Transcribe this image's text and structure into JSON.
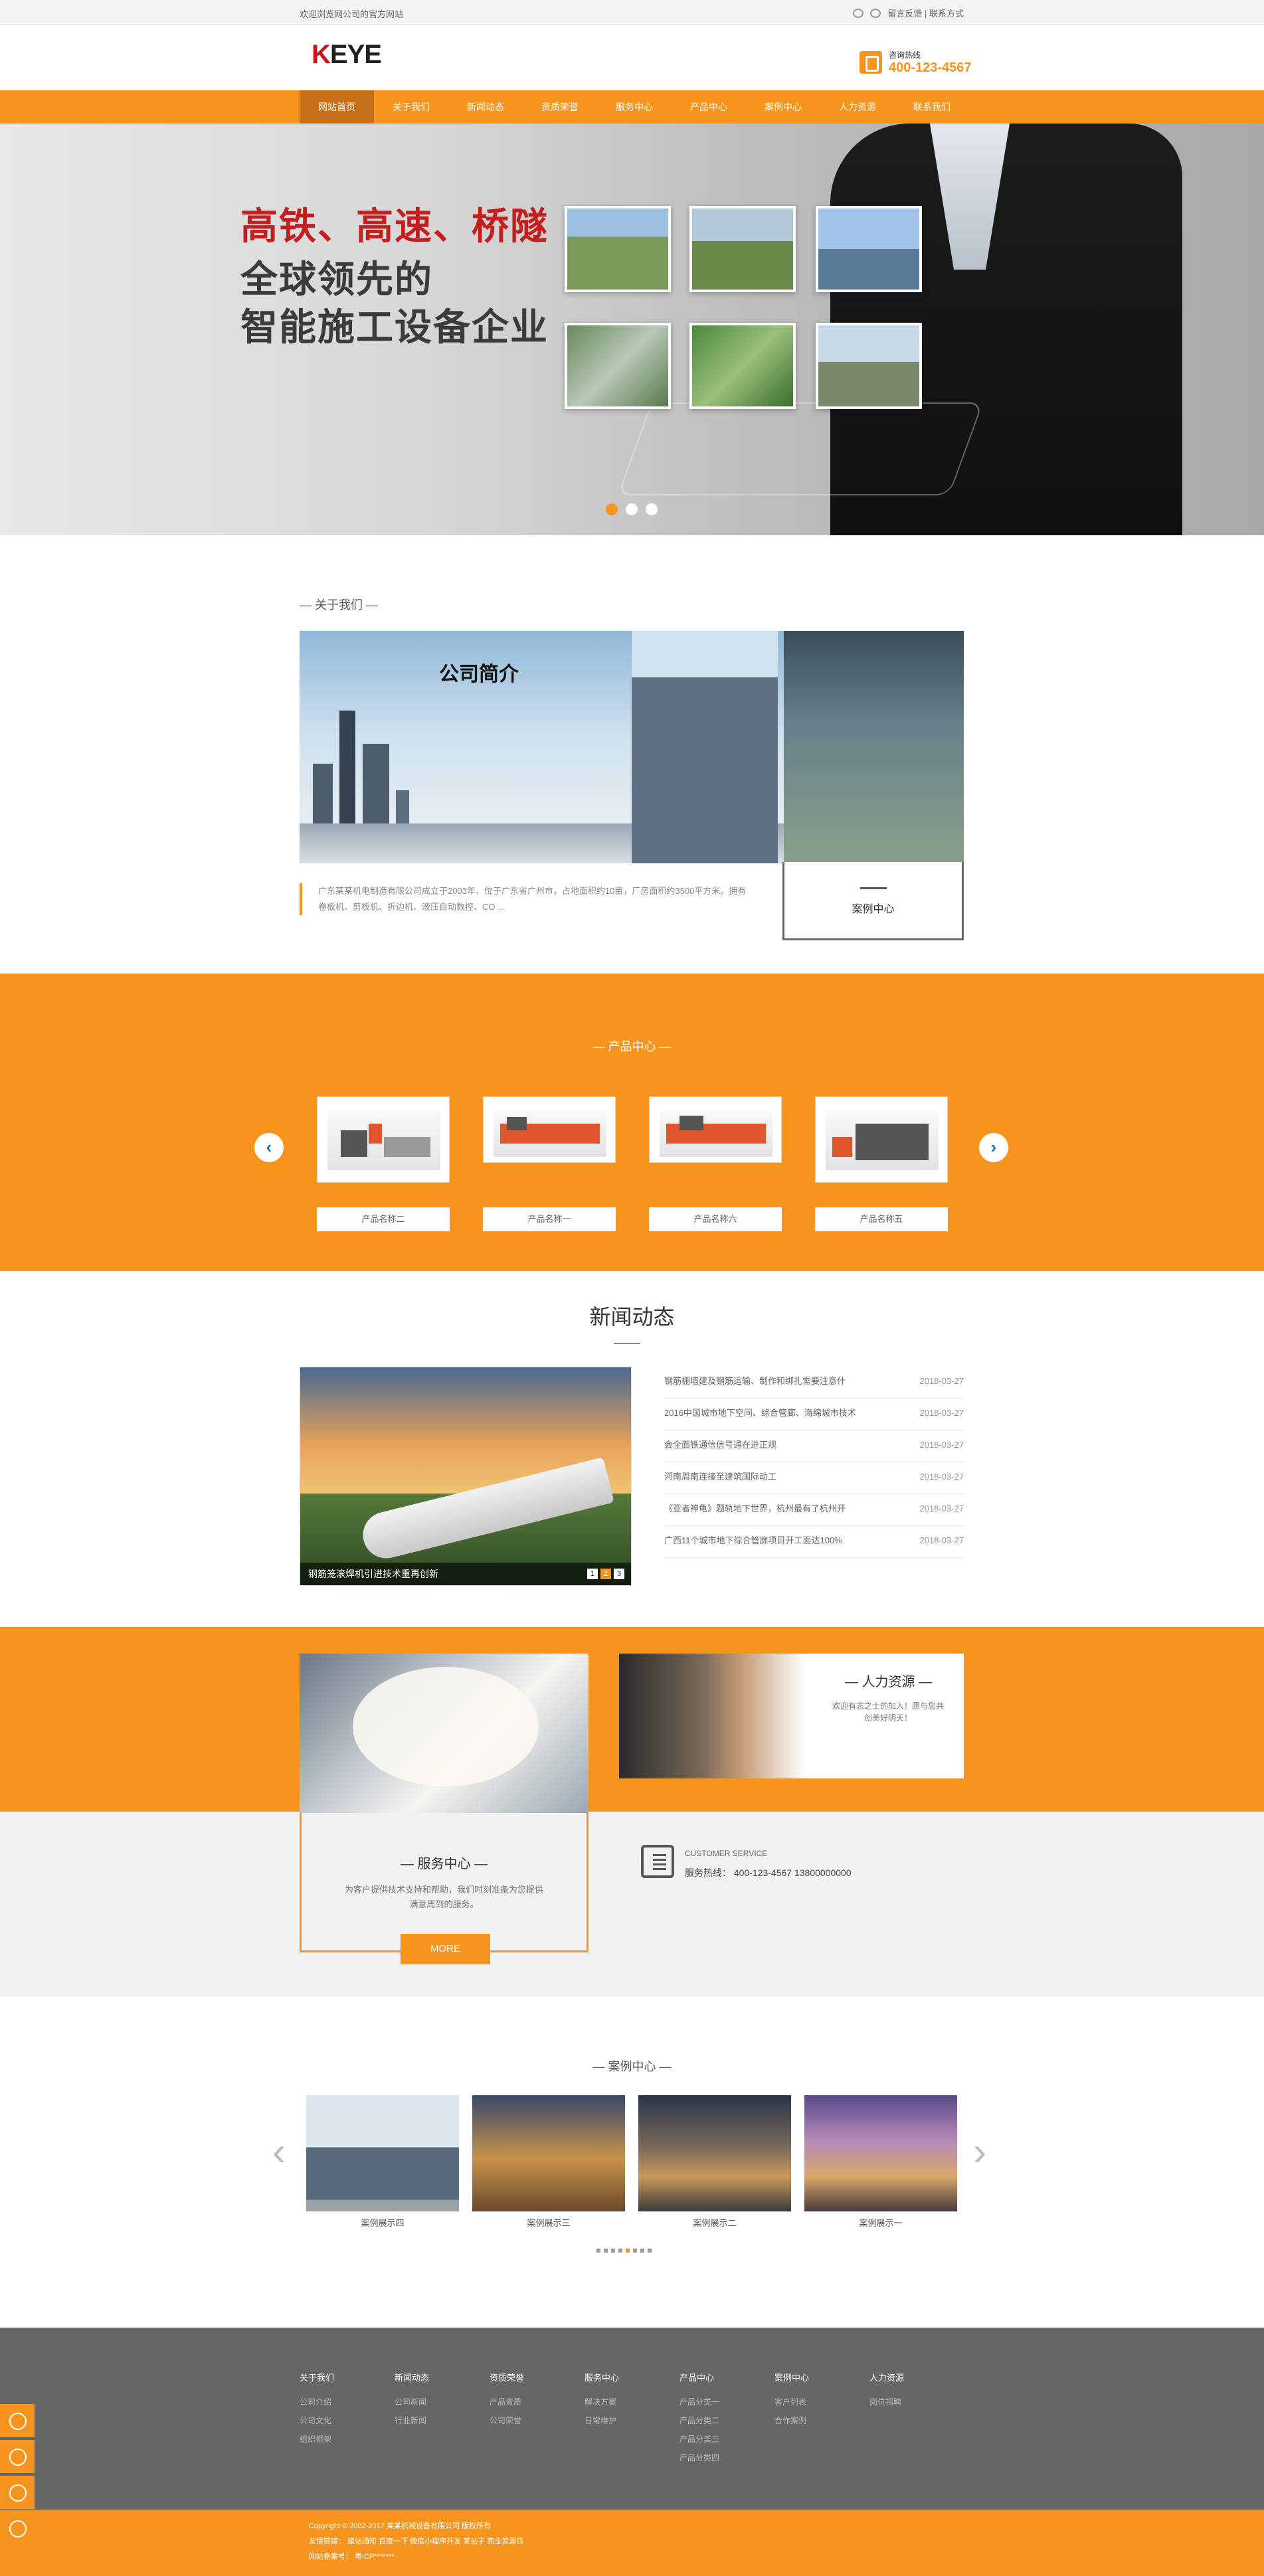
{
  "topbar": {
    "welcome": "欢迎浏览网公司的官方网站",
    "links": "留言反馈 | 联系方式"
  },
  "header": {
    "logo": "KEYE",
    "hotline_label": "咨询热线",
    "hotline_number": "400-123-4567"
  },
  "nav": [
    "网站首页",
    "关于我们",
    "新闻动态",
    "资质荣誉",
    "服务中心",
    "产品中心",
    "案例中心",
    "人力资源",
    "联系我们"
  ],
  "banner": {
    "line1": "高铁、高速、桥隧",
    "line2": "全球领先的",
    "line3": "智能施工设备企业"
  },
  "about": {
    "title": "— 关于我们 —",
    "img_title": "公司简介",
    "text": "广东某某机电制造有限公司成立于2003年，位于广东省广州市，占地面积约10亩，厂房面积约3500平方米。拥有卷板机、剪板机、折边机、液压自动数控、CO ...",
    "case_btn": "案例中心"
  },
  "products": {
    "title": "— 产品中心 —",
    "items": [
      "产品名称二",
      "产品名称一",
      "产品名称六",
      "产品名称五"
    ]
  },
  "news": {
    "title": "新闻动态",
    "caption": "钢筋笼滚焊机引进技术重再创新",
    "pages": [
      "1",
      "2",
      "3"
    ],
    "list": [
      {
        "t": "钢筋棚墙建及钢筋运输、制作和绑扎需要注意什",
        "d": "2018-03-27"
      },
      {
        "t": "2016中国城市地下空间、综合管廊、海绵城市技术",
        "d": "2018-03-27"
      },
      {
        "t": "会全面铁通信信号通在进正规",
        "d": "2018-03-27"
      },
      {
        "t": "河南周南连接至建筑国际动工",
        "d": "2018-03-27"
      },
      {
        "t": "《亚者神龟》题轨地下世界，杭州最有了杭州开",
        "d": "2018-03-27"
      },
      {
        "t": "广西11个城市地下综合管廊项目开工面达100%",
        "d": "2018-03-27"
      }
    ]
  },
  "hr": {
    "title": "— 人力资源 —",
    "desc": "欢迎有志之士的加入！愿与您共创美好明天！"
  },
  "service": {
    "title": "— 服务中心 —",
    "desc": "为客户提供技术支持和帮助，我们时刻准备为您提供满意周到的服务。",
    "more": "MORE",
    "cs_label": "CUSTOMER SERVICE",
    "cs_line": "服务热线：  400-123-4567  13800000000"
  },
  "cases": {
    "title": "— 案例中心 —",
    "items": [
      "案例展示四",
      "案例展示三",
      "案例展示二",
      "案例展示一"
    ]
  },
  "footer": {
    "cols": [
      {
        "h": "关于我们",
        "items": [
          "公司介绍",
          "公司文化",
          "组织框架"
        ]
      },
      {
        "h": "新闻动态",
        "items": [
          "公司新闻",
          "行业新闻"
        ]
      },
      {
        "h": "资质荣誉",
        "items": [
          "产品资质",
          "公司荣誉"
        ]
      },
      {
        "h": "服务中心",
        "items": [
          "解决方案",
          "日常维护"
        ]
      },
      {
        "h": "产品中心",
        "items": [
          "产品分类一",
          "产品分类二",
          "产品分类三",
          "产品分类四"
        ]
      },
      {
        "h": "案例中心",
        "items": [
          "客户列表",
          "合作案例"
        ]
      },
      {
        "h": "人力资源",
        "items": [
          "岗位招聘"
        ]
      }
    ],
    "copyright": "Copyright © 2002-2017 某某机械设备有限公司 版权所有",
    "links": "友情链接：  建站通知  百度一下  微信小程序开发  某站子  商业资源目",
    "icp": "网站备案号：  粤ICP*******"
  },
  "colors": {
    "accent": "#f7941d",
    "brand_red": "#c41f1f",
    "footer": "#666666"
  }
}
